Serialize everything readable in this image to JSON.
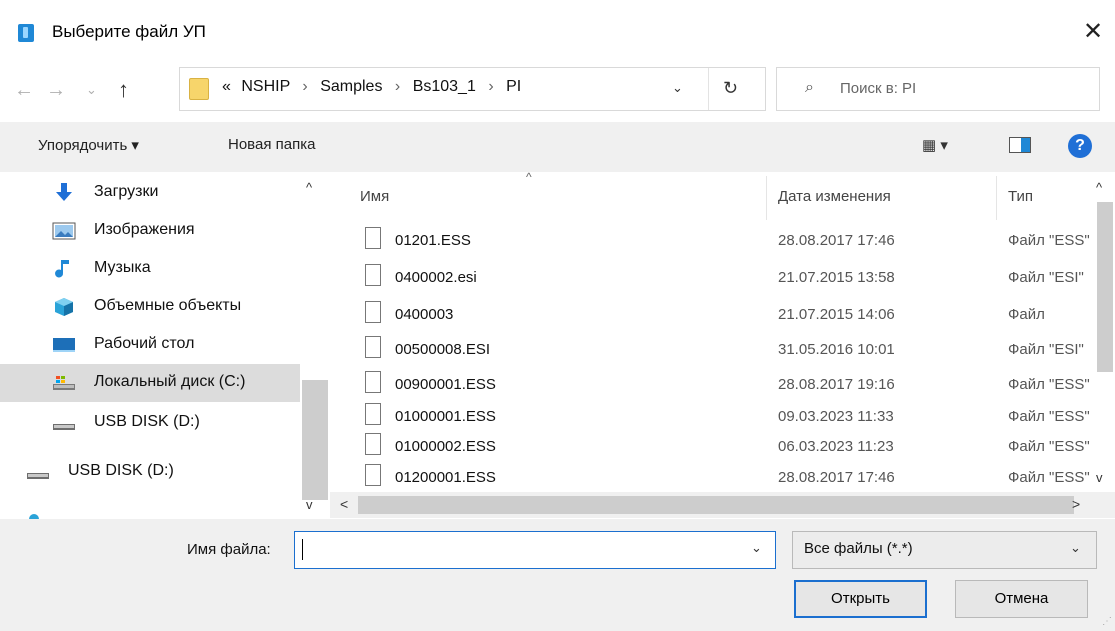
{
  "window": {
    "title": "Выберите файл УП",
    "close": "✕"
  },
  "nav": {
    "back": "←",
    "forward": "→",
    "recent": "⌄",
    "up": "↑",
    "breadcrumb": [
      "«",
      "NSHIP",
      "Samples",
      "Bs103_1",
      "PI"
    ],
    "separator": "›",
    "dropdown": "⌄",
    "refresh": "↻",
    "search_placeholder": "Поиск в: PI",
    "search_glyph": "⌕"
  },
  "toolbar": {
    "organize": "Упорядочить ▾",
    "new_folder": "Новая папка",
    "view": "▦ ▾",
    "help": "?"
  },
  "sidebar": {
    "items": [
      {
        "label": "Загрузки",
        "icon": "downloads-icon"
      },
      {
        "label": "Изображения",
        "icon": "pictures-icon"
      },
      {
        "label": "Музыка",
        "icon": "music-icon"
      },
      {
        "label": "Объемные объекты",
        "icon": "3d-objects-icon"
      },
      {
        "label": "Рабочий стол",
        "icon": "desktop-icon"
      },
      {
        "label": "Локальный диск (C:)",
        "icon": "local-disk-icon",
        "selected": true
      },
      {
        "label": "USB DISK (D:)",
        "icon": "usb-drive-icon"
      },
      {
        "label": "USB DISK (D:)",
        "icon": "usb-drive-icon"
      }
    ]
  },
  "filelist": {
    "columns": {
      "name": "Имя",
      "date": "Дата изменения",
      "type": "Тип"
    },
    "sort_glyph": "^",
    "rows": [
      {
        "name": "01201.ESS",
        "date": "28.08.2017 17:46",
        "type": "Файл \"ESS\""
      },
      {
        "name": "0400002.esi",
        "date": "21.07.2015 13:58",
        "type": "Файл \"ESI\""
      },
      {
        "name": "0400003",
        "date": "21.07.2015 14:06",
        "type": "Файл"
      },
      {
        "name": "00500008.ESI",
        "date": "31.05.2016 10:01",
        "type": "Файл \"ESI\""
      },
      {
        "name": "00900001.ESS",
        "date": "28.08.2017 19:16",
        "type": "Файл \"ESS\""
      },
      {
        "name": "01000001.ESS",
        "date": "09.03.2023 11:33",
        "type": "Файл \"ESS\""
      },
      {
        "name": "01000002.ESS",
        "date": "06.03.2023 11:23",
        "type": "Файл \"ESS\""
      },
      {
        "name": "01200001.ESS",
        "date": "28.08.2017 17:46",
        "type": "Файл \"ESS\""
      }
    ]
  },
  "scroll": {
    "up": "^",
    "down": "v",
    "left": "<",
    "right": ">"
  },
  "footer": {
    "filename_label": "Имя файла:",
    "filename_value": "",
    "filetype": "Все файлы (*.*)",
    "dropdown": "⌄",
    "open": "Открыть",
    "cancel": "Отмена",
    "grip": "⋰"
  }
}
